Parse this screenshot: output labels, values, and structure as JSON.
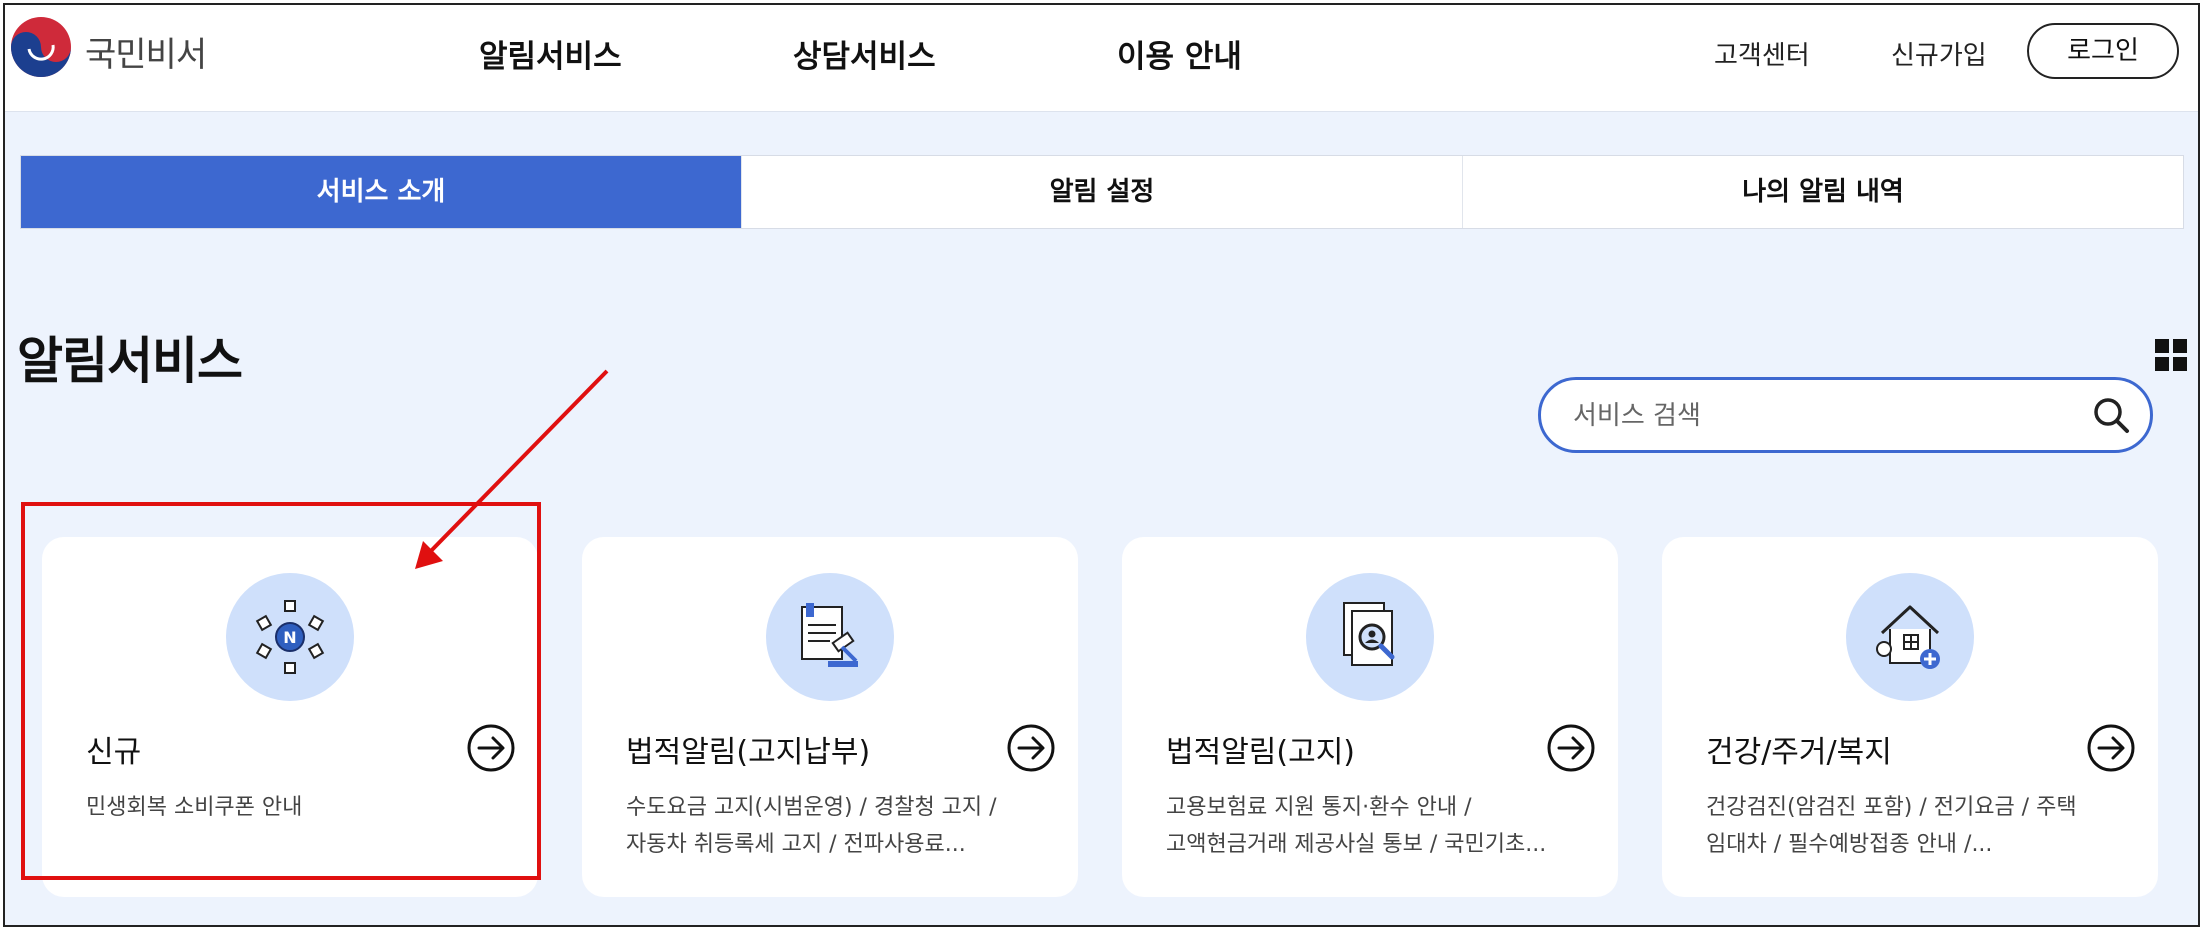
{
  "header": {
    "logo_text": "국민비서",
    "nav": [
      "알림서비스",
      "상담서비스",
      "이용 안내"
    ],
    "customer_center": "고객센터",
    "signup": "신규가입",
    "login": "로그인"
  },
  "tabs": [
    {
      "label": "서비스 소개",
      "active": true
    },
    {
      "label": "알림 설정",
      "active": false
    },
    {
      "label": "나의 알림 내역",
      "active": false
    }
  ],
  "main": {
    "title": "알림서비스",
    "search": {
      "placeholder": "서비스 검색",
      "value": ""
    }
  },
  "cards": [
    {
      "title": "신규",
      "icon": "new-badge-icon",
      "lines": [
        "민생회복 소비쿠폰 안내"
      ]
    },
    {
      "title": "법적알림(고지납부)",
      "icon": "legal-document-gavel-icon",
      "lines": [
        "수도요금 고지(시범운영)  /  경찰청 고지  /",
        "자동차 취등록세 고지  /  전파사용료..."
      ]
    },
    {
      "title": "법적알림(고지)",
      "icon": "document-magnifier-icon",
      "lines": [
        "고용보험료 지원 통지·환수 안내  /",
        "고액현금거래 제공사실 통보  /  국민기초..."
      ]
    },
    {
      "title": "건강/주거/복지",
      "icon": "house-health-icon",
      "lines": [
        "건강검진(암검진 포함)  /  전기요금  /  주택",
        "임대차  /  필수예방접종 안내  /..."
      ]
    }
  ],
  "colors": {
    "accent": "#3d68d0",
    "annotation": "#e01010",
    "icon_bg": "#cfe0fb",
    "page_bg": "#edf3fd"
  }
}
